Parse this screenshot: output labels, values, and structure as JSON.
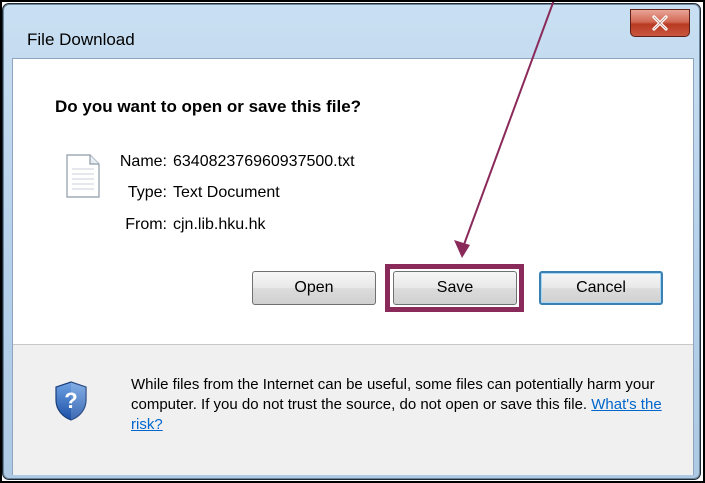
{
  "window": {
    "title": "File Download",
    "close_icon": "close-x-icon"
  },
  "dialog": {
    "question": "Do you want to open or save this file?",
    "file_icon": "text-document-icon",
    "file": {
      "name_label": "Name:",
      "name_value": "634082376960937500.txt",
      "type_label": "Type:",
      "type_value": "Text Document",
      "from_label": "From:",
      "from_value": "cjn.lib.hku.hk"
    },
    "buttons": {
      "open": "Open",
      "save": "Save",
      "cancel": "Cancel"
    }
  },
  "footer": {
    "shield_icon": "security-shield-icon",
    "warning_text": "While files from the Internet can be useful, some files can potentially harm your computer. If you do not trust the source, do not open or save this file.",
    "risk_link": "What's the risk?"
  },
  "annotation": {
    "color": "#8a2a5a",
    "arrow_target": "Save"
  }
}
